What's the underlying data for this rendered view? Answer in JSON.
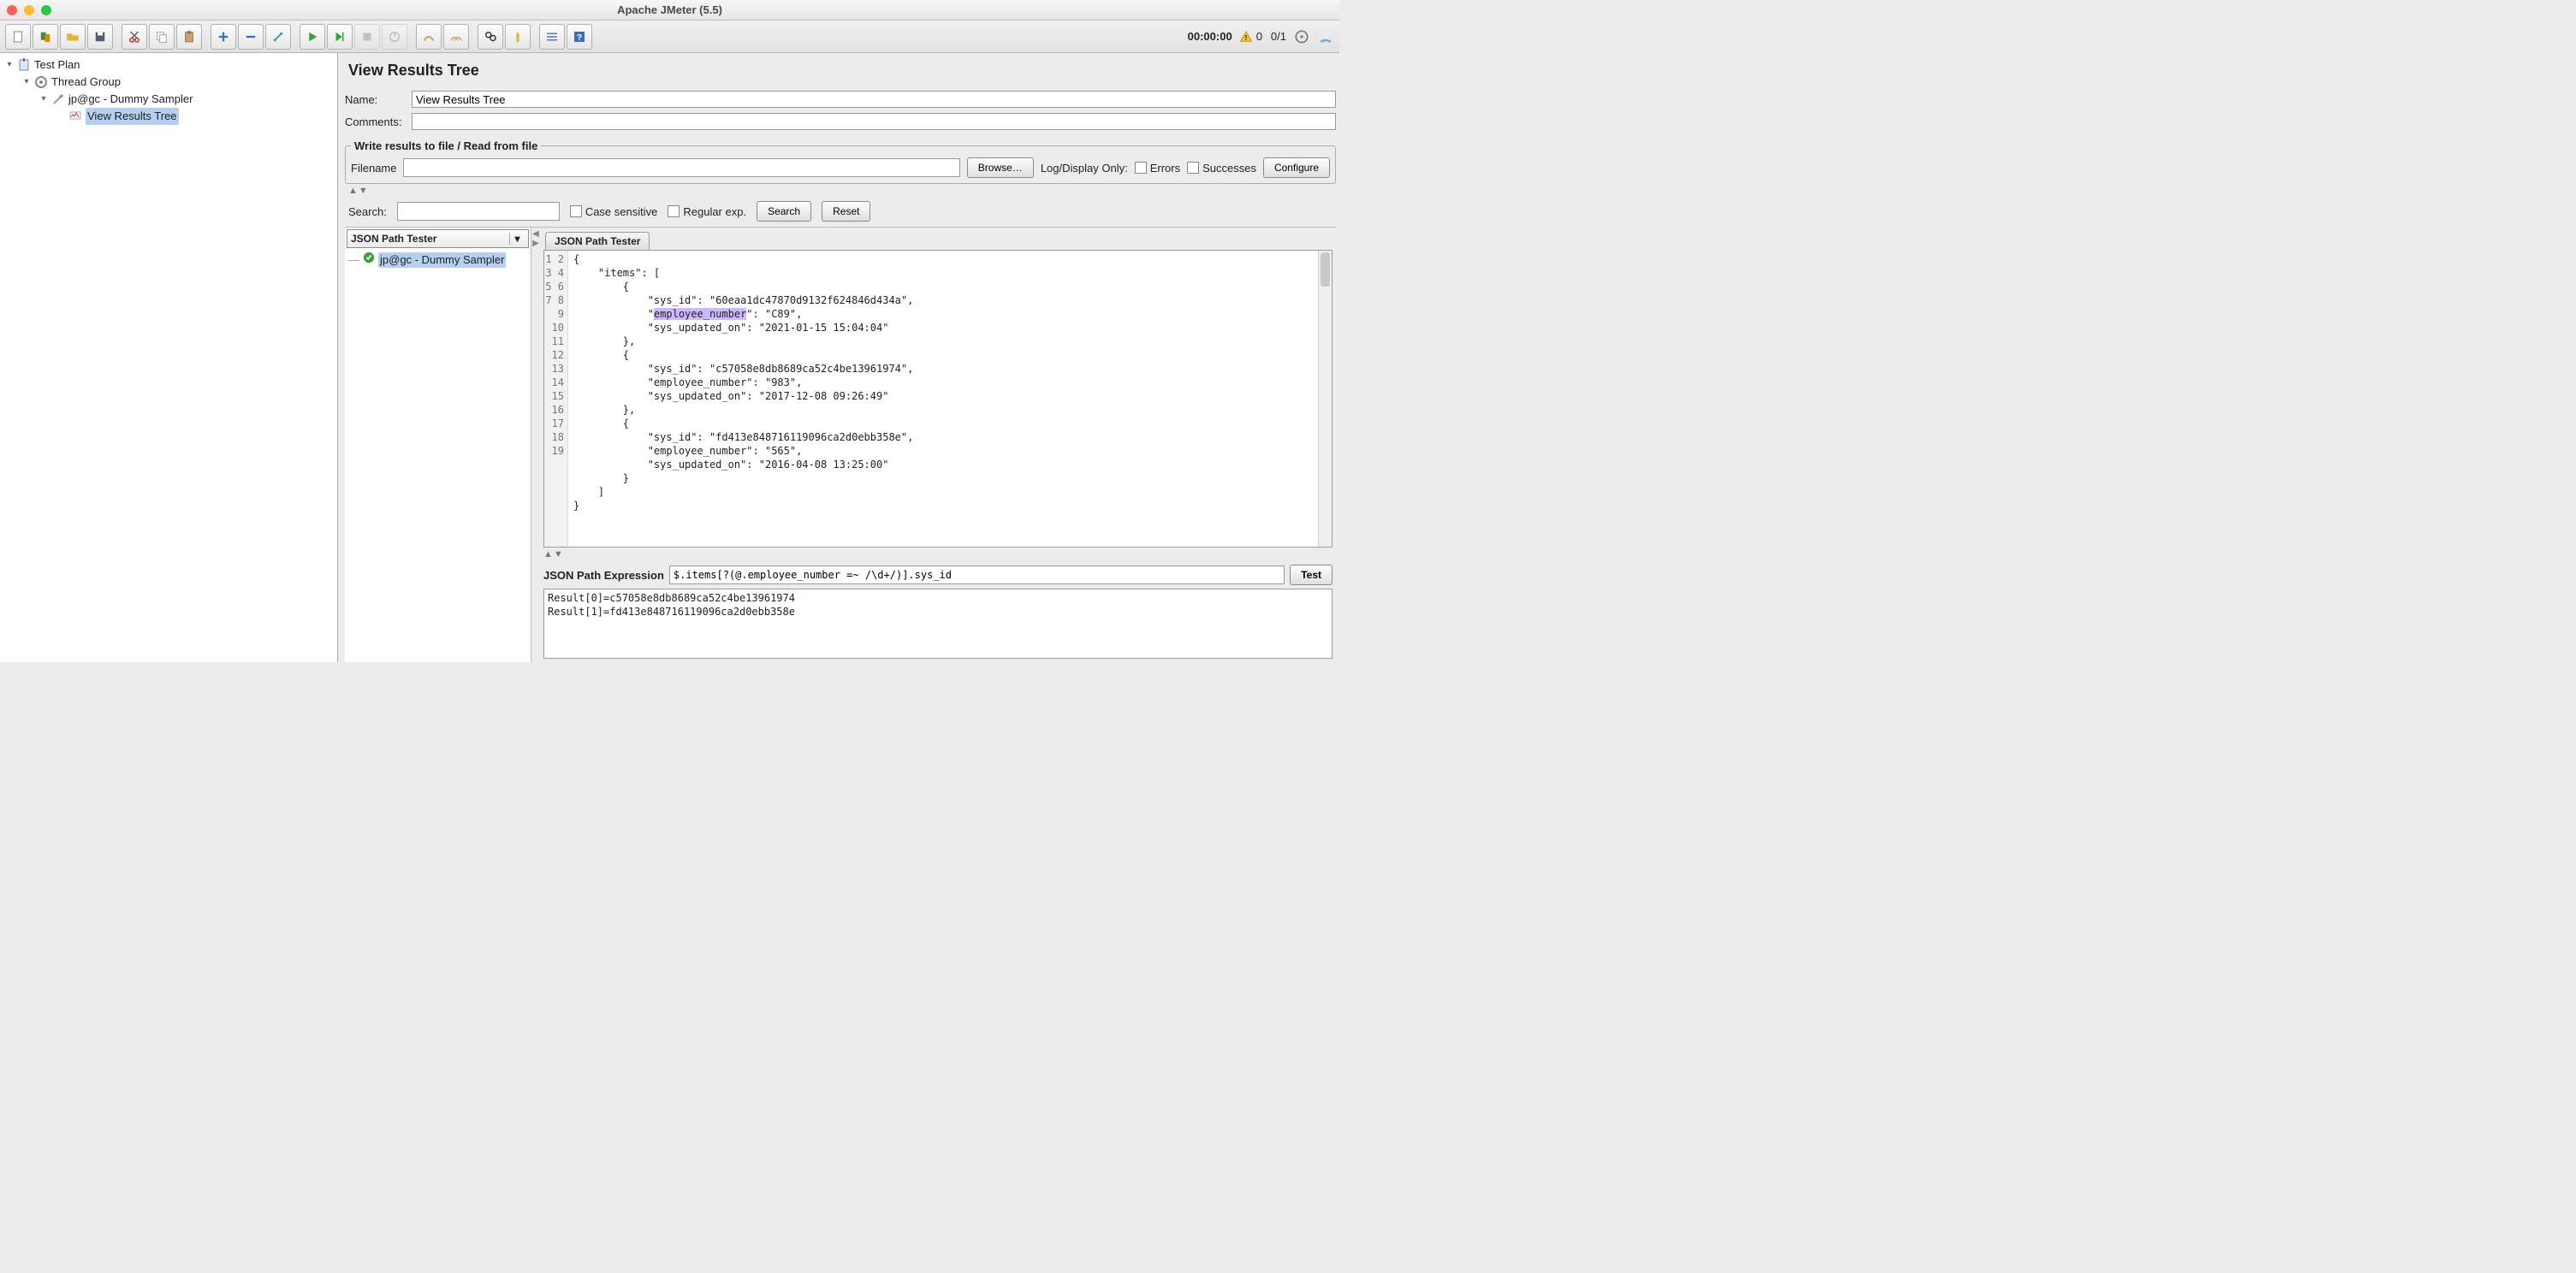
{
  "window_title": "Apache JMeter (5.5)",
  "toolbar": {
    "timer": "00:00:00",
    "warn_count": "0",
    "thread_counts": "0/1"
  },
  "tree": {
    "root": "Test Plan",
    "thread_group": "Thread Group",
    "sampler": "jp@gc - Dummy Sampler",
    "listener": "View Results Tree"
  },
  "panel": {
    "title": "View Results Tree",
    "name_label": "Name:",
    "name_value": "View Results Tree",
    "comments_label": "Comments:",
    "comments_value": "",
    "filebox_legend": "Write results to file / Read from file",
    "filename_label": "Filename",
    "filename_value": "",
    "browse": "Browse…",
    "log_display": "Log/Display Only:",
    "errors": "Errors",
    "successes": "Successes",
    "configure": "Configure"
  },
  "search": {
    "label": "Search:",
    "value": "",
    "case": "Case sensitive",
    "regex": "Regular exp.",
    "btn_search": "Search",
    "btn_reset": "Reset"
  },
  "renderer": {
    "selected": "JSON Path Tester",
    "result_item": "jp@gc - Dummy Sampler"
  },
  "tab_label": "JSON Path Tester",
  "code_lines": [
    "{",
    "    \"items\": [",
    "        {",
    "            \"sys_id\": \"60eaa1dc47870d9132f624846d434a\",",
    "            \"employee_number\": \"C89\",",
    "            \"sys_updated_on\": \"2021-01-15 15:04:04\"",
    "        },",
    "        {",
    "            \"sys_id\": \"c57058e8db8689ca52c4be13961974\",",
    "            \"employee_number\": \"983\",",
    "            \"sys_updated_on\": \"2017-12-08 09:26:49\"",
    "        },",
    "        {",
    "            \"sys_id\": \"fd413e848716119096ca2d0ebb358e\",",
    "            \"employee_number\": \"565\",",
    "            \"sys_updated_on\": \"2016-04-08 13:25:00\"",
    "        }",
    "    ]",
    "}"
  ],
  "expr": {
    "label": "JSON Path Expression",
    "value": "$.items[?(@.employee_number =~ /\\d+/)].sys_id",
    "test": "Test"
  },
  "results_out": "Result[0]=c57058e8db8689ca52c4be13961974\nResult[1]=fd413e848716119096ca2d0ebb358e"
}
